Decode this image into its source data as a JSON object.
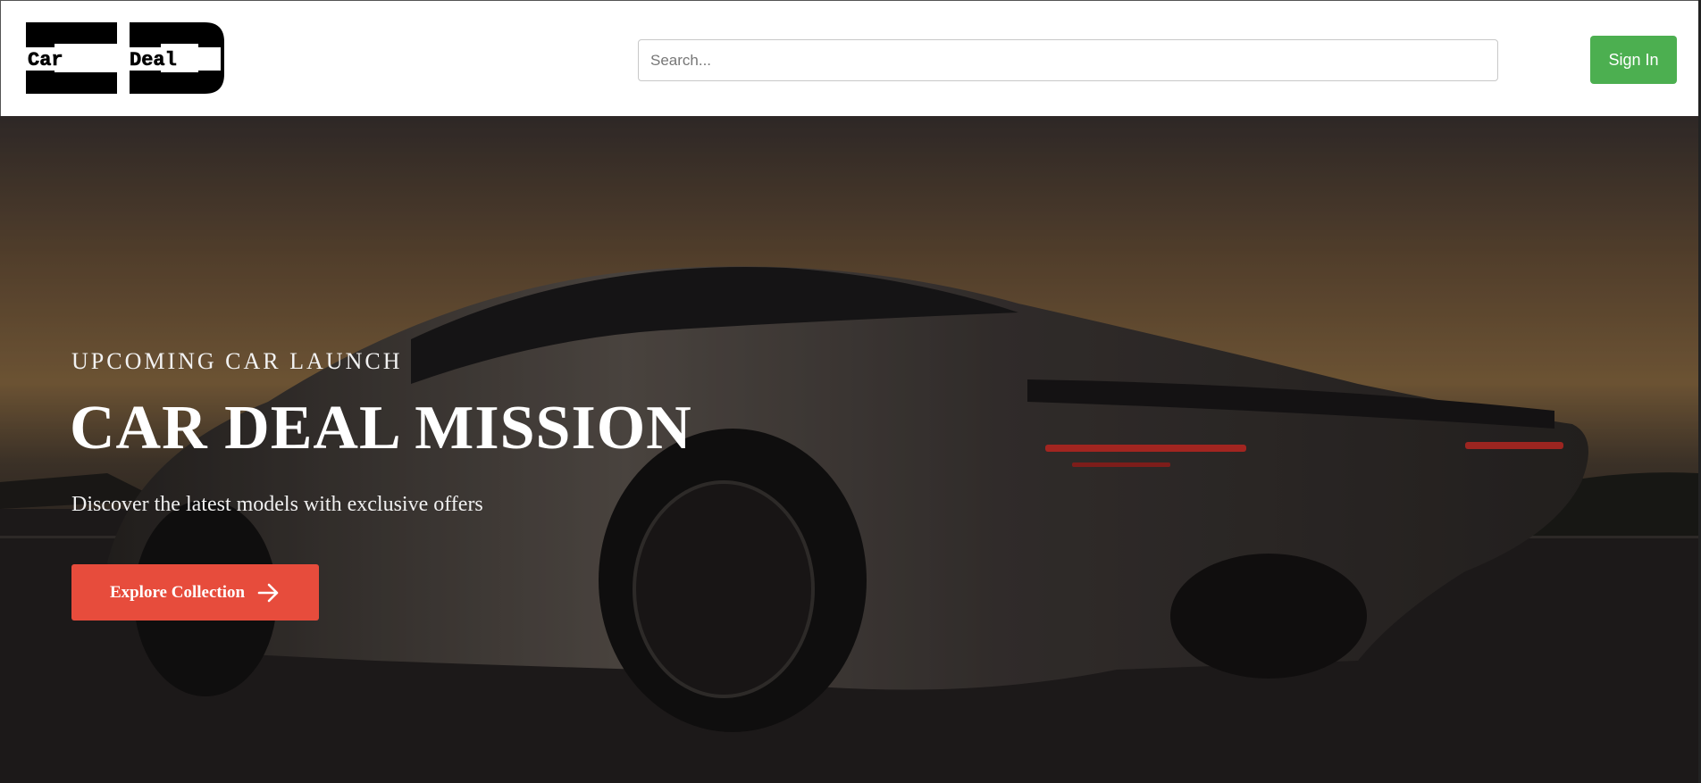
{
  "header": {
    "logo": {
      "text": "Car Deal",
      "mark": "CD"
    },
    "search": {
      "placeholder": "Search...",
      "value": ""
    },
    "signin_label": "Sign In"
  },
  "hero": {
    "eyebrow": "UPCOMING CAR LAUNCH",
    "title": "CAR DEAL MISSION",
    "subtitle": "Discover the latest models with exclusive offers",
    "cta_label": "Explore Collection",
    "cta_icon": "arrow-right-icon",
    "image": "sports-car-sunset-photo"
  },
  "colors": {
    "signin": "#4caf50",
    "cta": "#e74c3c",
    "nav_bg": "#ffffff"
  }
}
